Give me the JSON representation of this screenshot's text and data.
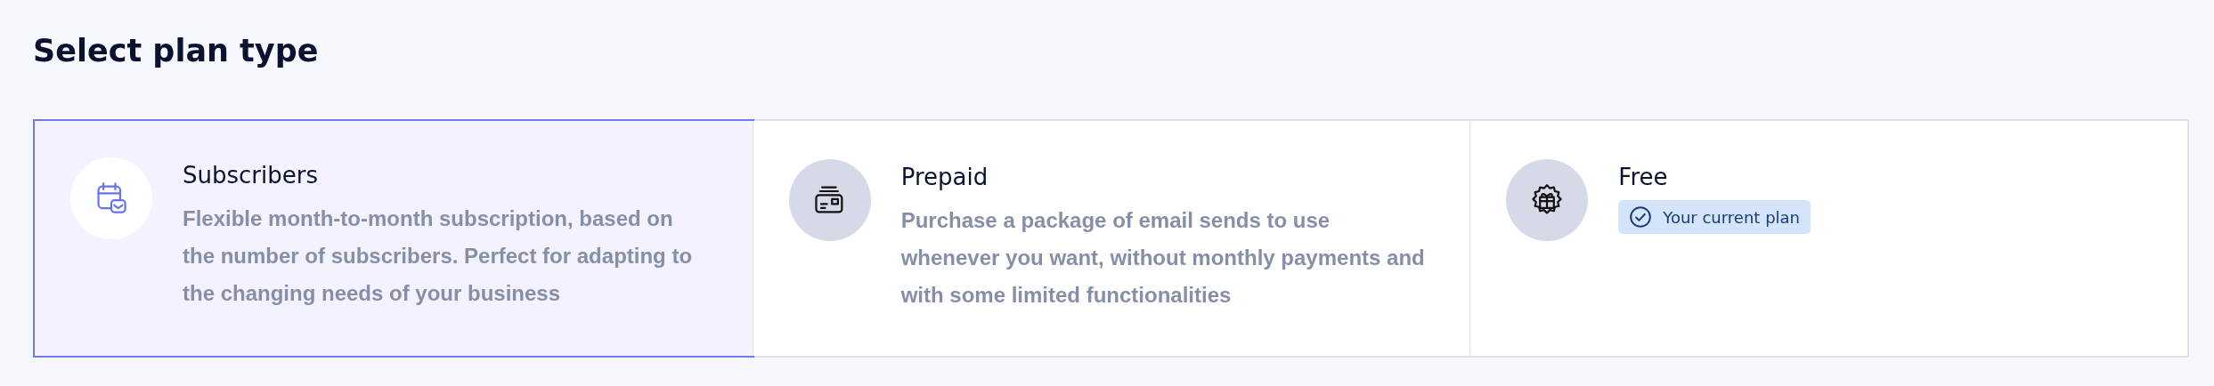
{
  "heading": "Select plan type",
  "plans": [
    {
      "name": "Subscribers",
      "description": "Flexible month-to-month subscription, based on the number of subscribers. Perfect for adapting to the changing needs of your business",
      "selected": true
    },
    {
      "name": "Prepaid",
      "description": "Purchase a package of email sends to use whenever you want, without monthly payments and with some limited functionalities",
      "selected": false
    },
    {
      "name": "Free",
      "badge": "Your current plan",
      "selected": false
    }
  ]
}
